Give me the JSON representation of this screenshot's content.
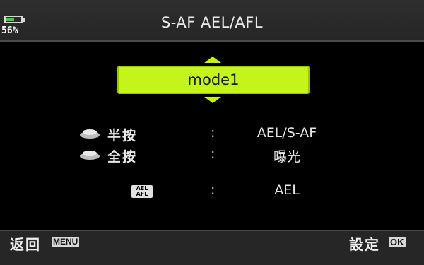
{
  "status": {
    "battery_percent": "56%",
    "battery_level": 0.56
  },
  "header": {
    "title": "S-AF AEL/AFL"
  },
  "selector": {
    "value": "mode1"
  },
  "settings": [
    {
      "label": "半按",
      "colon": ":",
      "value": "AEL/S-AF",
      "icon": "shutter-half-press-icon"
    },
    {
      "label": "全按",
      "colon": ":",
      "value": "曝光",
      "icon": "shutter-full-press-icon"
    },
    {
      "icon_text_top": "AEL",
      "icon_text_bottom": "AFL",
      "colon": ":",
      "value": "AEL",
      "icon": "ael-afl-button-icon"
    }
  ],
  "footer": {
    "back_label": "返回",
    "back_badge": "MENU",
    "set_label": "設定",
    "set_badge": "OK"
  },
  "colors": {
    "accent": "#c3f51a",
    "battery_fill": "#3ecf3e"
  }
}
